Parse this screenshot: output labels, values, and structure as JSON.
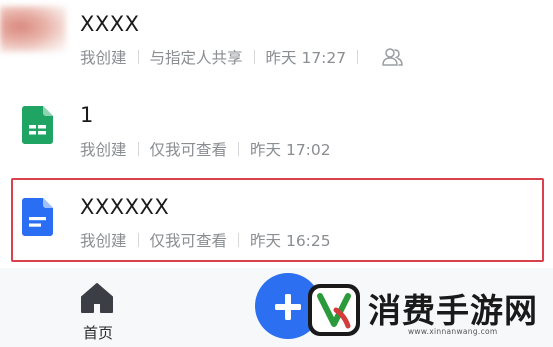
{
  "files": [
    {
      "name": "XXXX",
      "creator": "我创建",
      "permission": "与指定人共享",
      "time": "昨天 17:27",
      "icon": "image-thumbnail-icon",
      "shared_icon": "shared-people-icon"
    },
    {
      "name": "1",
      "creator": "我创建",
      "permission": "仅我可查看",
      "time": "昨天 17:02",
      "icon": "spreadsheet-icon"
    },
    {
      "name": "XXXXXX",
      "creator": "我创建",
      "permission": "仅我可查看",
      "time": "昨天 16:25",
      "icon": "document-icon",
      "highlighted": true
    }
  ],
  "bottom_nav": {
    "home_label": "首页",
    "home_icon": "home-icon",
    "create_icon": "plus-icon"
  },
  "watermark": {
    "text": "消费手游网",
    "url": "www.xinnanwang.com"
  },
  "colors": {
    "highlight_border": "#d9414c",
    "fab": "#2c6ff0",
    "sheet_green": "#1fa463",
    "doc_blue": "#2a6ff3",
    "meta_gray": "#8a8d91"
  }
}
